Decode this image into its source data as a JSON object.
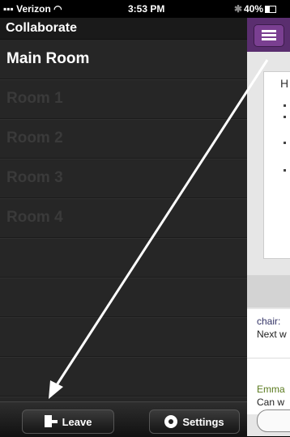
{
  "status": {
    "carrier": "Verizon",
    "time": "3:53 PM",
    "battery": "40%"
  },
  "sidebar": {
    "title": "Collaborate",
    "rooms": [
      {
        "label": "Main Room"
      },
      {
        "label": "Room 1"
      },
      {
        "label": "Room 2"
      },
      {
        "label": "Room 3"
      },
      {
        "label": "Room 4"
      }
    ]
  },
  "footer": {
    "leave_label": "Leave",
    "settings_label": "Settings"
  },
  "panel": {
    "card_heading": "H",
    "chat": [
      {
        "author": "chair:",
        "text": "Next w"
      },
      {
        "author": "Emma",
        "text": "Can w"
      }
    ]
  },
  "colors": {
    "accent": "#5a2e6f",
    "arrow": "#ffffff"
  }
}
